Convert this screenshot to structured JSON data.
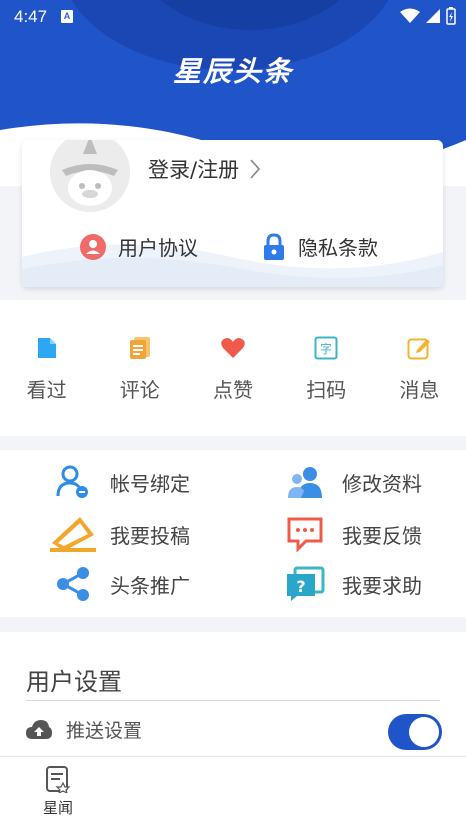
{
  "status_bar": {
    "time": "4:47",
    "notification_letter": "A"
  },
  "header": {
    "brand": "星辰头条"
  },
  "profile": {
    "avatar": "avatar-placeholder",
    "login_label": "登录/注册",
    "user_agreement": "用户协议",
    "privacy_policy": "隐私条款"
  },
  "quick_actions": [
    {
      "label": "看过",
      "icon": "document-icon",
      "color": "#2ea7f2"
    },
    {
      "label": "评论",
      "icon": "comment-list-icon",
      "color": "#f2a33a"
    },
    {
      "label": "点赞",
      "icon": "heart-icon",
      "color": "#f05a4a"
    },
    {
      "label": "扫码",
      "icon": "scan-char-icon",
      "color": "#3bb6c4"
    },
    {
      "label": "消息",
      "icon": "edit-note-icon",
      "color": "#f2b42e"
    }
  ],
  "menu": [
    {
      "label": "帐号绑定",
      "icon": "account-bind-icon"
    },
    {
      "label": "修改资料",
      "icon": "edit-profile-icon"
    },
    {
      "label": "我要投稿",
      "icon": "contribute-icon"
    },
    {
      "label": "我要反馈",
      "icon": "feedback-icon"
    },
    {
      "label": "头条推广",
      "icon": "share-icon"
    },
    {
      "label": "我要求助",
      "icon": "help-icon"
    }
  ],
  "settings": {
    "title": "用户设置",
    "push_label": "推送设置",
    "push_enabled": true
  },
  "tabbar": {
    "tab_label": "星闻"
  },
  "colors": {
    "brand_blue": "#1f55c9",
    "background": "#f2f4f7"
  }
}
